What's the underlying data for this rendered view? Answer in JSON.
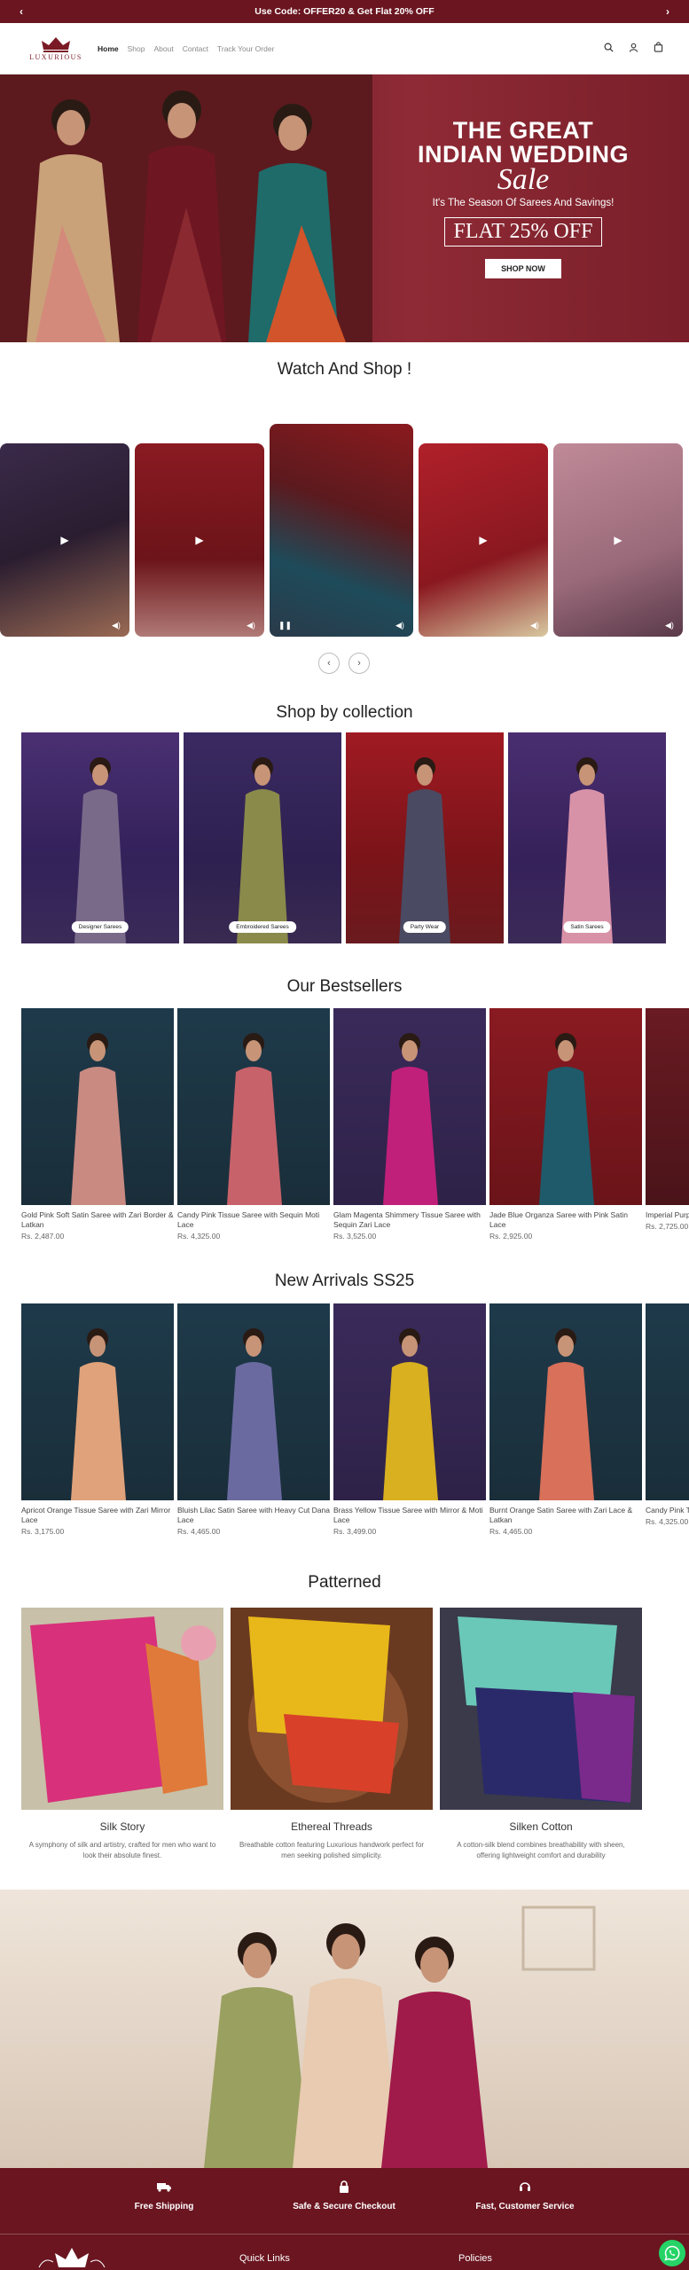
{
  "announcement": {
    "text": "Use Code: OFFER20 & Get Flat 20% OFF",
    "prev": "‹",
    "next": "›"
  },
  "header": {
    "logo_text": "LUXURIOUS",
    "nav": [
      "Home",
      "Shop",
      "About",
      "Contact",
      "Track Your Order"
    ]
  },
  "hero": {
    "line1": "THE GREAT",
    "line2": "INDIAN WEDDING",
    "line3": "Sale",
    "line4": "It's The Season Of Sarees And Savings!",
    "offer": "FLAT 25% OFF",
    "cta": "SHOP NOW"
  },
  "watch": {
    "title": "Watch And Shop !"
  },
  "collections": {
    "title": "Shop by collection",
    "items": [
      "Designer Sarees",
      "Embroidered Sarees",
      "Party Wear",
      "Satin Sarees"
    ]
  },
  "bestsellers": {
    "title": "Our Bestsellers",
    "items": [
      {
        "name": "Gold Pink Soft Satin Saree with Zari Border & Latkan",
        "price": "Rs. 2,487.00"
      },
      {
        "name": "Candy Pink Tissue Saree with Sequin Moti Lace",
        "price": "Rs. 4,325.00"
      },
      {
        "name": "Glam Magenta Shimmery Tissue Saree with Sequin Zari Lace",
        "price": "Rs. 3,525.00"
      },
      {
        "name": "Jade Blue Organza Saree with Pink Satin Lace",
        "price": "Rs. 2,925.00"
      },
      {
        "name": "Imperial Purp",
        "price": "Rs. 2,725.00"
      }
    ]
  },
  "arrivals": {
    "title": "New Arrivals SS25",
    "items": [
      {
        "name": "Apricot Orange Tissue Saree with Zari Mirror Lace",
        "price": "Rs. 3,175.00"
      },
      {
        "name": "Bluish Lilac Satin Saree with Heavy Cut Dana Lace",
        "price": "Rs. 4,465.00"
      },
      {
        "name": "Brass Yellow Tissue Saree with Mirror & Moti Lace",
        "price": "Rs. 3,499.00"
      },
      {
        "name": "Burnt Orange Satin Saree with Zari Lace & Latkan",
        "price": "Rs. 4,465.00"
      },
      {
        "name": "Candy Pink Ti",
        "price": "Rs. 4,325.00"
      }
    ]
  },
  "patterned": {
    "title": "Patterned",
    "items": [
      {
        "title": "Silk Story",
        "desc": "A symphony of silk and artistry, crafted for men who want to look their absolute finest."
      },
      {
        "title": "Ethereal Threads",
        "desc": "Breathable cotton featuring Luxurious handwork perfect for men seeking polished simplicity."
      },
      {
        "title": "Silken Cotton",
        "desc": "A cotton-silk blend combines breathability with sheen, offering lightweight comfort and durability"
      }
    ]
  },
  "footer": {
    "features": [
      "Free Shipping",
      "Safe & Secure Checkout",
      "Fast, Customer Service"
    ],
    "cols": [
      "Quick Links",
      "Policies"
    ]
  },
  "colors": {
    "brand": "#6a1520",
    "accent_gold": "#c9a24a"
  }
}
